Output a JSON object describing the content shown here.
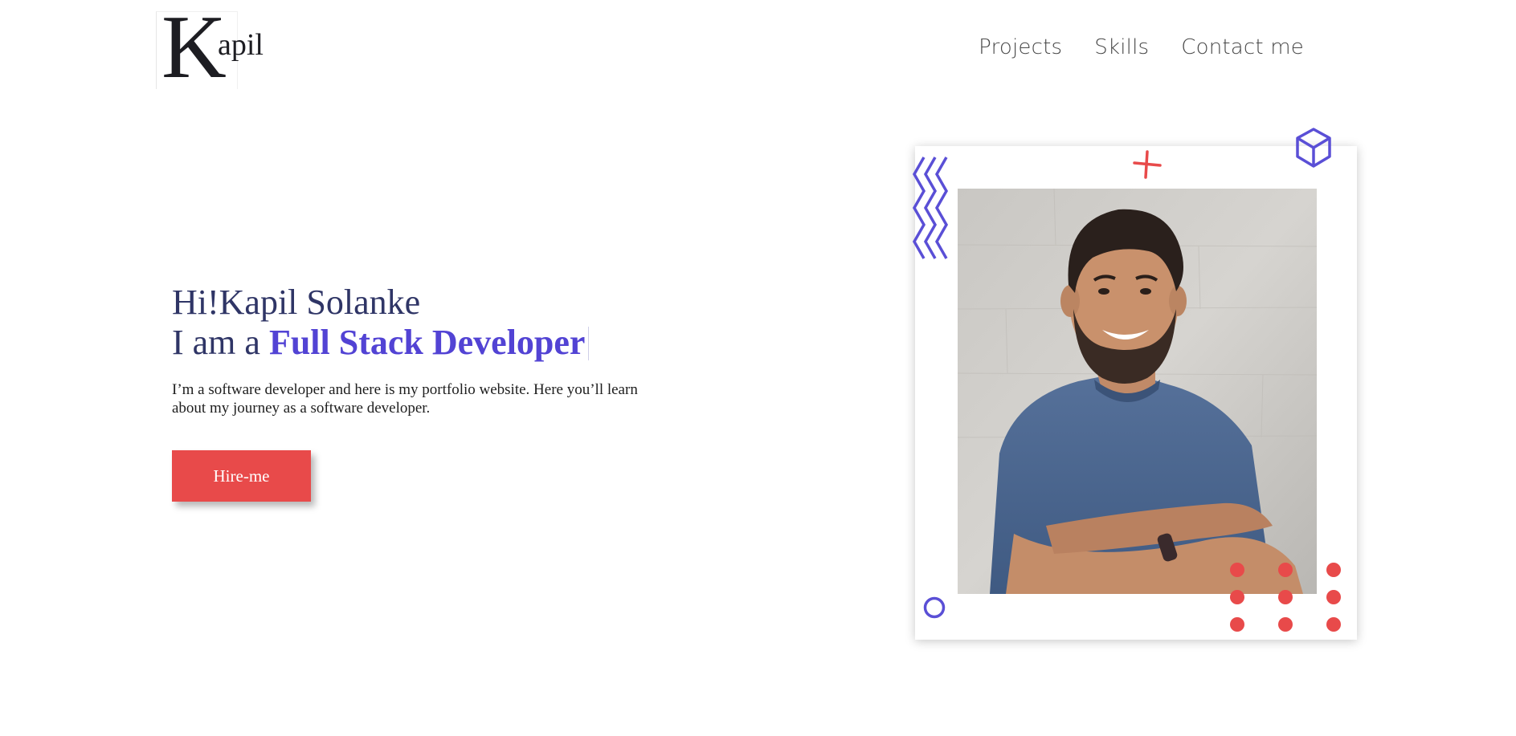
{
  "logo": {
    "letter": "K",
    "rest": "apil"
  },
  "nav": [
    {
      "label": "Projects"
    },
    {
      "label": "Skills"
    },
    {
      "label": "Contact me"
    }
  ],
  "hero": {
    "greeting": "Hi!Kapil Solanke",
    "role_prefix": "I am a ",
    "role": "Full Stack Developer",
    "description": "I’m a software developer and here is my portfolio website. Here you’ll learn about my journey as a software developer.",
    "cta": "Hire-me"
  },
  "colors": {
    "accent_red": "#e84a4a",
    "accent_purple": "#5243d4",
    "heading": "#2f3566"
  },
  "icons": [
    "zigzag-icon",
    "plus-icon",
    "cube-icon",
    "ring-icon",
    "dot-grid-icon"
  ]
}
